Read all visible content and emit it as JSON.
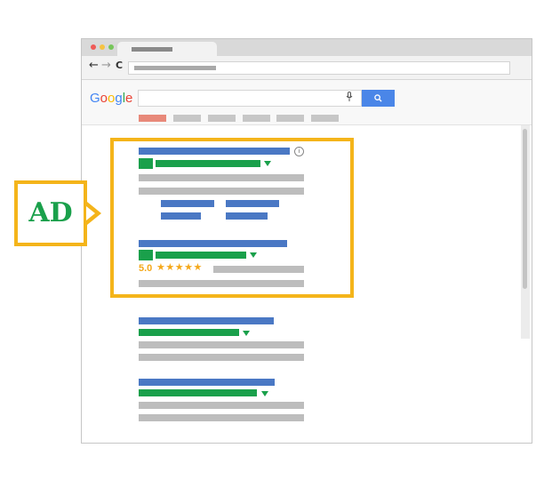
{
  "browser": {
    "nav_back": "←",
    "nav_forward": "→",
    "nav_reload": "C"
  },
  "google": {
    "logo_letters": [
      {
        "char": "G",
        "color": "#4285f4"
      },
      {
        "char": "o",
        "color": "#ea4335"
      },
      {
        "char": "o",
        "color": "#fbbc05"
      },
      {
        "char": "g",
        "color": "#4285f4"
      },
      {
        "char": "l",
        "color": "#34a853"
      },
      {
        "char": "e",
        "color": "#ea4335"
      }
    ],
    "search_button_icon": "search-icon",
    "mic_icon": "microphone-icon"
  },
  "ad": {
    "label": "AD",
    "info_icon": "i",
    "rating": "5.0",
    "stars": "★★★★★"
  },
  "colors": {
    "accent": "#f4b41a",
    "ad_text": "#1aa04b",
    "link": "#4a78c4",
    "url": "#1aa04b",
    "text_placeholder": "#bdbdbd",
    "tab_active": "#e8897a"
  }
}
